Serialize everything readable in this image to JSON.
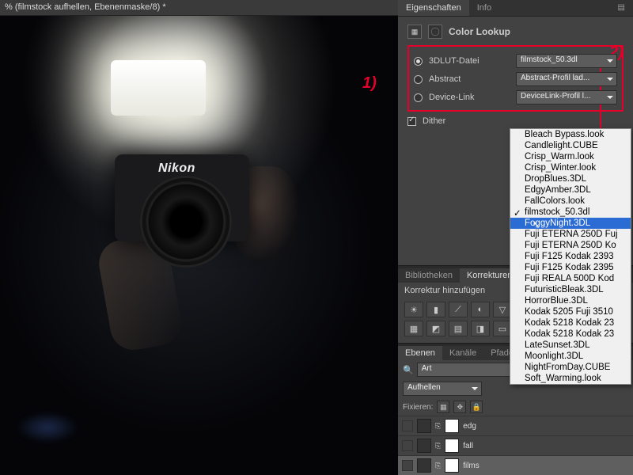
{
  "doc_title": "% (filmstock aufhellen, Ebenenmaske/8) *",
  "camera_brand": "Nikon",
  "annotations": {
    "label1": "1)",
    "label2": "2)"
  },
  "properties": {
    "tab_props": "Eigenschaften",
    "tab_info": "Info",
    "section_title": "Color Lookup",
    "rows": {
      "lut": {
        "label": "3DLUT-Datei",
        "value": "filmstock_50.3dl"
      },
      "abstract": {
        "label": "Abstract",
        "value": "Abstract-Profil lad..."
      },
      "devicelink": {
        "label": "Device-Link",
        "value": "DeviceLink-Profil l..."
      }
    },
    "dither_label": "Dither"
  },
  "secondary": {
    "tab_bib": "Bibliotheken",
    "tab_korr": "Korrekturen",
    "add_label": "Korrektur hinzufügen"
  },
  "layers_panel": {
    "tab_layers": "Ebenen",
    "tab_channels": "Kanäle",
    "tab_paths": "Pfade",
    "filter_label": "Art",
    "blend_mode": "Aufhellen",
    "lock_label": "Fixieren:",
    "layers": [
      {
        "name": "edg"
      },
      {
        "name": "fall"
      },
      {
        "name": "films"
      }
    ]
  },
  "lut_menu": {
    "items": [
      "Bleach Bypass.look",
      "Candlelight.CUBE",
      "Crisp_Warm.look",
      "Crisp_Winter.look",
      "DropBlues.3DL",
      "EdgyAmber.3DL",
      "FallColors.look",
      "filmstock_50.3dl",
      "FoggyNight.3DL",
      "Fuji ETERNA 250D Fuj",
      "Fuji ETERNA 250D Ko",
      "Fuji F125 Kodak 2393",
      "Fuji F125 Kodak 2395",
      "Fuji REALA 500D Kod",
      "FuturisticBleak.3DL",
      "HorrorBlue.3DL",
      "Kodak 5205 Fuji 3510",
      "Kodak 5218 Kodak 23",
      "Kodak 5218 Kodak 23",
      "LateSunset.3DL",
      "Moonlight.3DL",
      "NightFromDay.CUBE",
      "Soft_Warming.look"
    ],
    "checked_index": 7,
    "highlight_index": 8
  }
}
